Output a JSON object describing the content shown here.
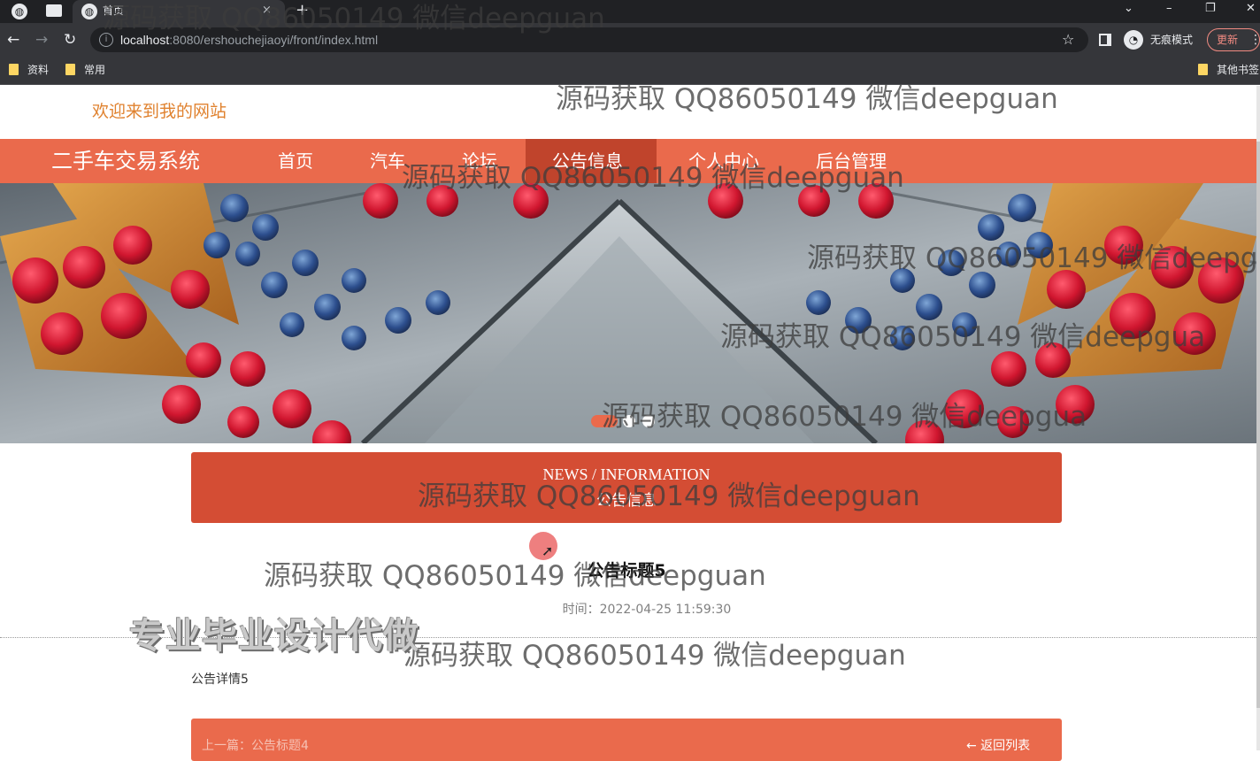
{
  "browser": {
    "tab_title": "首页",
    "tab_close": "×",
    "tab_new": "+",
    "url_host": "localhost",
    "url_rest": ":8080/ershouchejiaoyi/front/index.html",
    "incognito_label": "无痕模式",
    "update_label": "更新",
    "bookmarks": [
      "资料",
      "常用"
    ],
    "other_bookmarks": "其他书签"
  },
  "page": {
    "welcome": "欢迎来到我的网站",
    "site_name": "二手车交易系统",
    "nav": [
      "首页",
      "汽车",
      "论坛",
      "公告信息",
      "个人中心",
      "后台管理"
    ],
    "nav_active_index": 3,
    "section_en": "NEWS / INFORMATION",
    "section_cn": "公告信息",
    "article": {
      "title": "公告标题5",
      "time_label": "时间：",
      "time_value": "2022-04-25 11:59:30",
      "content": "公告详情5"
    },
    "footer": {
      "prev": "上一篇：公告标题4",
      "back": "← 返回列表"
    },
    "colors": {
      "primary": "#ea6a4c",
      "primary_dark": "#d44d34",
      "welcome": "#e0822f"
    }
  },
  "overlays": {
    "watermark": "源码获取 QQ86050149 微信deepguan",
    "watermark_cut": "源码获取 QQ86050149 微信deepgua",
    "ad": "专业毕业设计代做"
  }
}
